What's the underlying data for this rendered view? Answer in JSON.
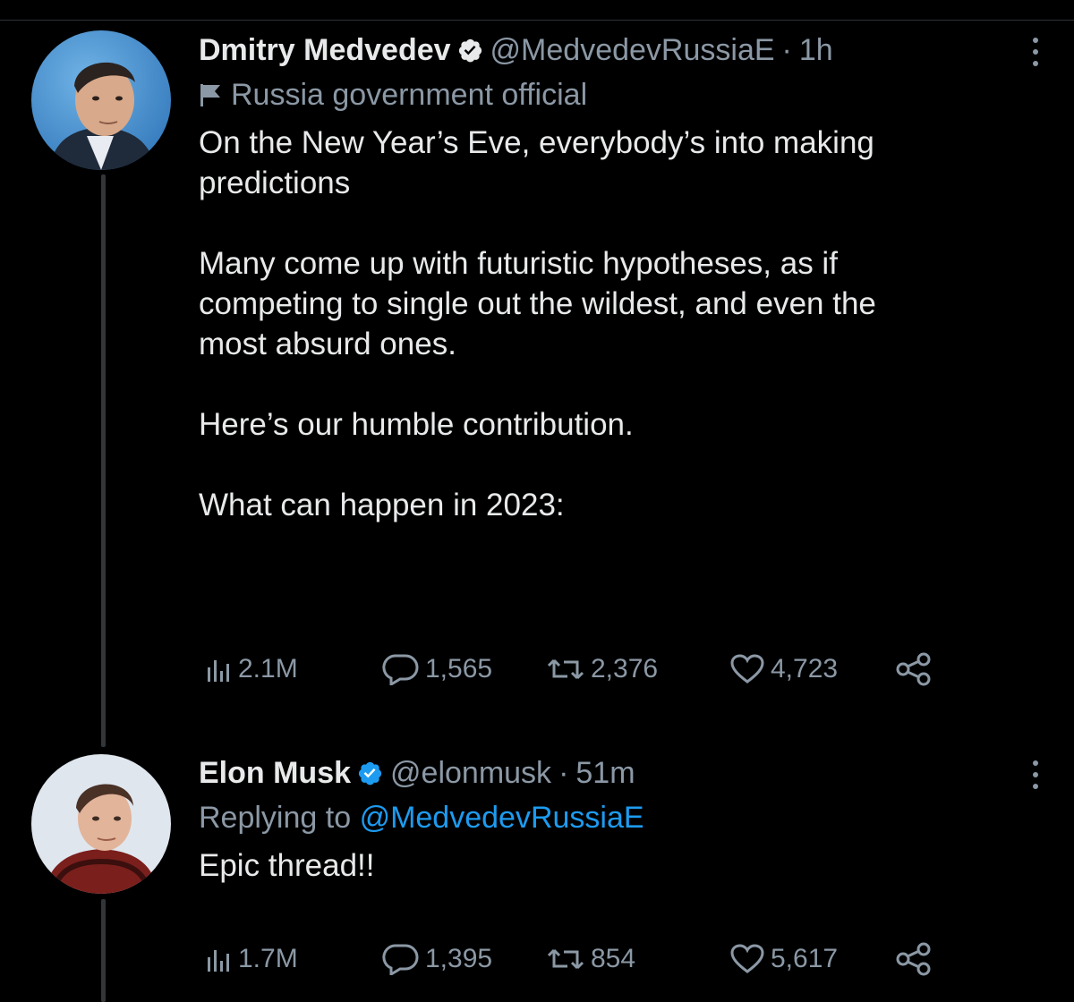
{
  "tweets": [
    {
      "author_name": "Dmitry Medvedev",
      "handle": "@MedvedevRussiaE",
      "time": "1h",
      "label": "Russia government official",
      "paragraphs": [
        "On the New Year’s Eve, everybody’s into making\npredictions",
        "Many come up with futuristic hypotheses, as if\ncompeting to single out the wildest, and even the\nmost absurd ones.",
        "Here’s our humble contribution.",
        "What can happen in 2023:"
      ],
      "stats": {
        "views": "2.1M",
        "replies": "1,565",
        "retweets": "2,376",
        "likes": "4,723"
      }
    },
    {
      "author_name": "Elon Musk",
      "handle": "@elonmusk",
      "time": "51m",
      "replying_prefix": "Replying to",
      "replying_handle": "@MedvedevRussiaE",
      "paragraphs": [
        "Epic thread!!"
      ],
      "stats": {
        "views": "1.7M",
        "replies": "1,395",
        "retweets": "854",
        "likes": "5,617"
      }
    }
  ],
  "icons": {
    "verified": "verified-badge-icon",
    "flag": "flag-icon",
    "views": "views-bar-chart-icon",
    "reply": "reply-bubble-icon",
    "retweet": "retweet-icon",
    "like": "heart-icon",
    "share": "share-icon",
    "more": "more-vertical-icon"
  },
  "colors": {
    "background": "#000000",
    "text": "#e7e9ea",
    "muted": "#8b98a5",
    "link": "#1d9bf0",
    "verified": "#1d9bf0"
  }
}
